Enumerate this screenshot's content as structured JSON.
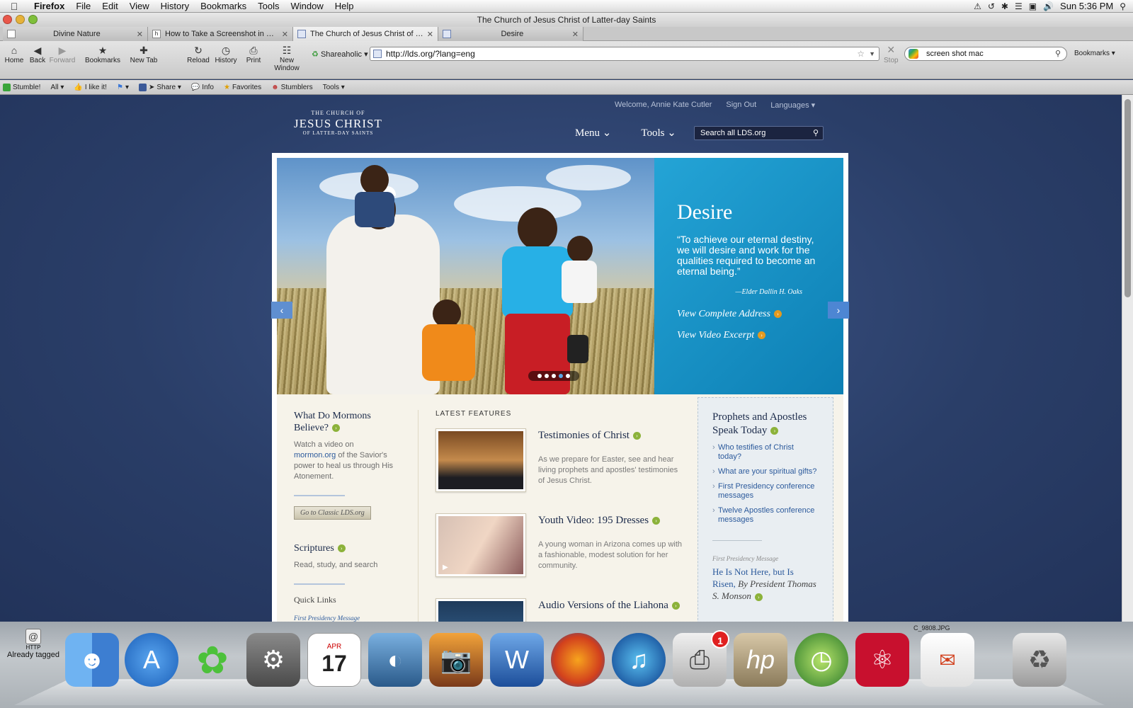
{
  "menubar": {
    "apple_icon": "apple-logo-icon",
    "app": "Firefox",
    "items": [
      "File",
      "Edit",
      "View",
      "History",
      "Bookmarks",
      "Tools",
      "Window",
      "Help"
    ],
    "clock": "Sun 5:36 PM"
  },
  "window": {
    "title": "The Church of Jesus Christ of Latter-day Saints"
  },
  "tabs": [
    {
      "label": "Divine Nature",
      "active": false
    },
    {
      "label": "How to Take a Screenshot in Ma...",
      "active": false
    },
    {
      "label": "The Church of Jesus Christ of L...",
      "active": true
    },
    {
      "label": "Desire",
      "active": false
    }
  ],
  "toolbar": {
    "home": "Home",
    "back": "Back",
    "forward": "Forward",
    "bookmarks": "Bookmarks",
    "new_tab": "New Tab",
    "reload": "Reload",
    "history": "History",
    "print": "Print",
    "new_window": "New Window",
    "shareaholic": "Shareaholic ▾",
    "stop": "Stop",
    "url": "http://lds.org/?lang=eng",
    "search_value": "screen shot mac",
    "bookmarks_menu": "Bookmarks ▾"
  },
  "stumblebar": {
    "stumble": "Stumble!",
    "all": "All ▾",
    "like": "I like it!",
    "share": "Share ▾",
    "info": "Info",
    "favorites": "Favorites",
    "stumblers": "Stumblers",
    "tools": "Tools ▾"
  },
  "site": {
    "logo": {
      "line1": "THE CHURCH OF",
      "line2": "JESUS CHRIST",
      "line3": "OF LATTER-DAY SAINTS"
    },
    "welcome": "Welcome, Annie Kate Cutler",
    "sign_out": "Sign Out",
    "languages": "Languages ▾",
    "menu": "Menu ⌄",
    "tools": "Tools ⌄",
    "search_placeholder": "Search all LDS.org"
  },
  "hero": {
    "title": "Desire",
    "quote": "“To achieve our eternal destiny, we will desire and work for the qualities required to become an eternal being.”",
    "attribution": "—Elder Dallin H. Oaks",
    "link1": "View Complete Address",
    "link2": "View Video Excerpt",
    "slides_total": 5,
    "slide_active": 4
  },
  "left_col": {
    "heading1": "What Do Mormons Believe?",
    "text1_pre": "Watch a video on",
    "text1_link": "mormon.org",
    "text1_post": "of the Savior's power to heal us through His Atonement.",
    "classic_button": "Go to Classic LDS.org",
    "heading2": "Scriptures",
    "text2": "Read, study, and search",
    "quick_links": "Quick Links",
    "quick_link1": "First Presidency Message"
  },
  "features": {
    "label": "LATEST FEATURES",
    "items": [
      {
        "title": "Testimonies of Christ",
        "desc": "As we prepare for Easter, see and hear living prophets and apostles' testimonies of Jesus Christ."
      },
      {
        "title": "Youth Video: 195 Dresses",
        "desc": "A young woman in Arizona comes up with a fashionable, modest solution for her community."
      },
      {
        "title": "Audio Versions of the Liahona",
        "desc": ""
      }
    ]
  },
  "right_col": {
    "heading": "Prophets and Apostles Speak Today",
    "links": [
      "Who testifies of Christ today?",
      "What are your spiritual gifts?",
      "First Presidency conference messages",
      "Twelve Apostles conference messages"
    ],
    "message_label": "First Presidency Message",
    "message_title": "He Is Not Here, but Is Risen,",
    "message_by": "By President Thomas S. Monson"
  },
  "dock": {
    "already_tagged": "Already tagged",
    "http_label": "HTTP",
    "items": [
      "finder-icon",
      "app-store-icon",
      "mindmap-icon",
      "system-preferences-icon",
      "calendar-icon",
      "iphoto-icon",
      "image-capture-icon",
      "microsoft-word-icon",
      "firefox-icon",
      "itunes-icon",
      "printer-icon",
      "hp-utility-icon",
      "time-machine-icon",
      "adobe-reader-icon",
      "documents-stack-icon",
      "trash-icon"
    ],
    "calendar_month": "APR",
    "calendar_day": "17",
    "printer_badge": "1",
    "hp_label": "hp",
    "stack_label": "C_9808.JPG"
  }
}
